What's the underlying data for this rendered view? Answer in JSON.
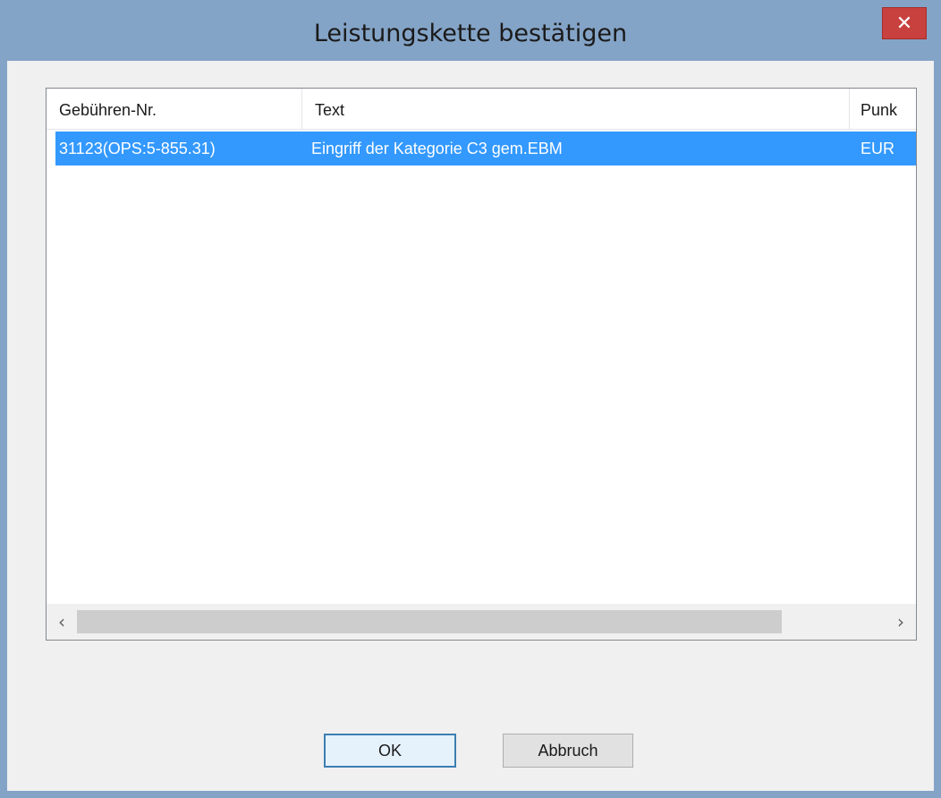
{
  "window": {
    "title": "Leistungskette bestätigen",
    "close_glyph": "✕",
    "accent": "#84a4c7",
    "close_color": "#c8413e"
  },
  "list": {
    "columns": [
      "Gebühren-Nr.",
      "Text",
      "Punk"
    ],
    "rows": [
      [
        "31123(OPS:5-855.31)",
        "Eingriff der Kategorie C3 gem.EBM",
        "EUR"
      ]
    ],
    "selection_color": "#3399ff",
    "scroll_left_glyph": "‹",
    "scroll_right_glyph": "›"
  },
  "buttons": {
    "ok": "OK",
    "cancel": "Abbruch"
  }
}
